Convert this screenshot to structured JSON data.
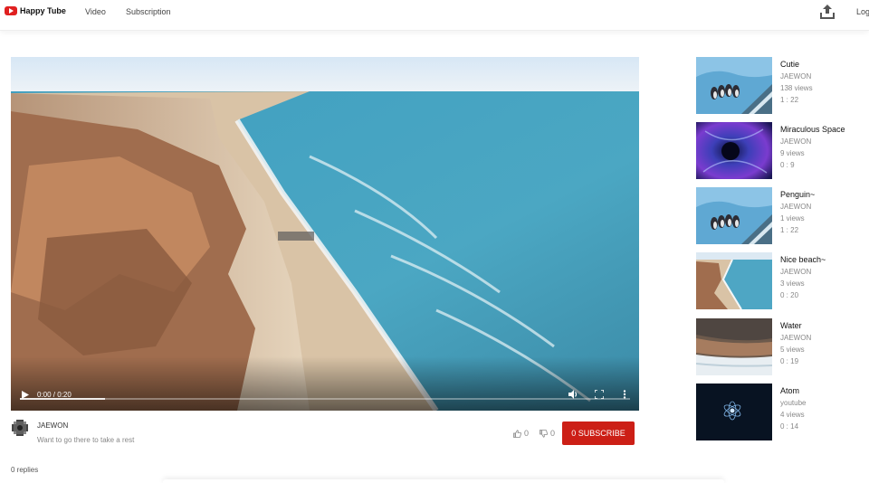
{
  "header": {
    "brand": "Happy Tube",
    "nav": [
      "Video",
      "Subscription"
    ],
    "login_label": "Log"
  },
  "player": {
    "time_display": "0:00 / 0:20",
    "progress_fraction": 0.14
  },
  "video": {
    "uploader": "JAEWON",
    "description": "Want to go there to take a rest",
    "likes": "0",
    "dislikes": "0",
    "subscribe_label": "0 SUBSCRIBE"
  },
  "comments": {
    "count_label": "0 replies"
  },
  "sidebar": {
    "items": [
      {
        "title": "Cutie",
        "channel": "JAEWON",
        "views": "138 views",
        "duration": "1 : 22",
        "thumb": "penguins"
      },
      {
        "title": "Miraculous Space",
        "channel": "JAEWON",
        "views": "9 views",
        "duration": "0 : 9",
        "thumb": "space"
      },
      {
        "title": "Penguin~",
        "channel": "JAEWON",
        "views": "1 views",
        "duration": "1 : 22",
        "thumb": "penguins"
      },
      {
        "title": "Nice beach~",
        "channel": "JAEWON",
        "views": "3 views",
        "duration": "0 : 20",
        "thumb": "beach"
      },
      {
        "title": "Water",
        "channel": "JAEWON",
        "views": "5 views",
        "duration": "0 : 19",
        "thumb": "water"
      },
      {
        "title": "Atom",
        "channel": "youtube",
        "views": "4 views",
        "duration": "0 : 14",
        "thumb": "atom"
      }
    ]
  },
  "colors": {
    "brand_red": "#e02020",
    "subscribe_red": "#cc1f16"
  }
}
